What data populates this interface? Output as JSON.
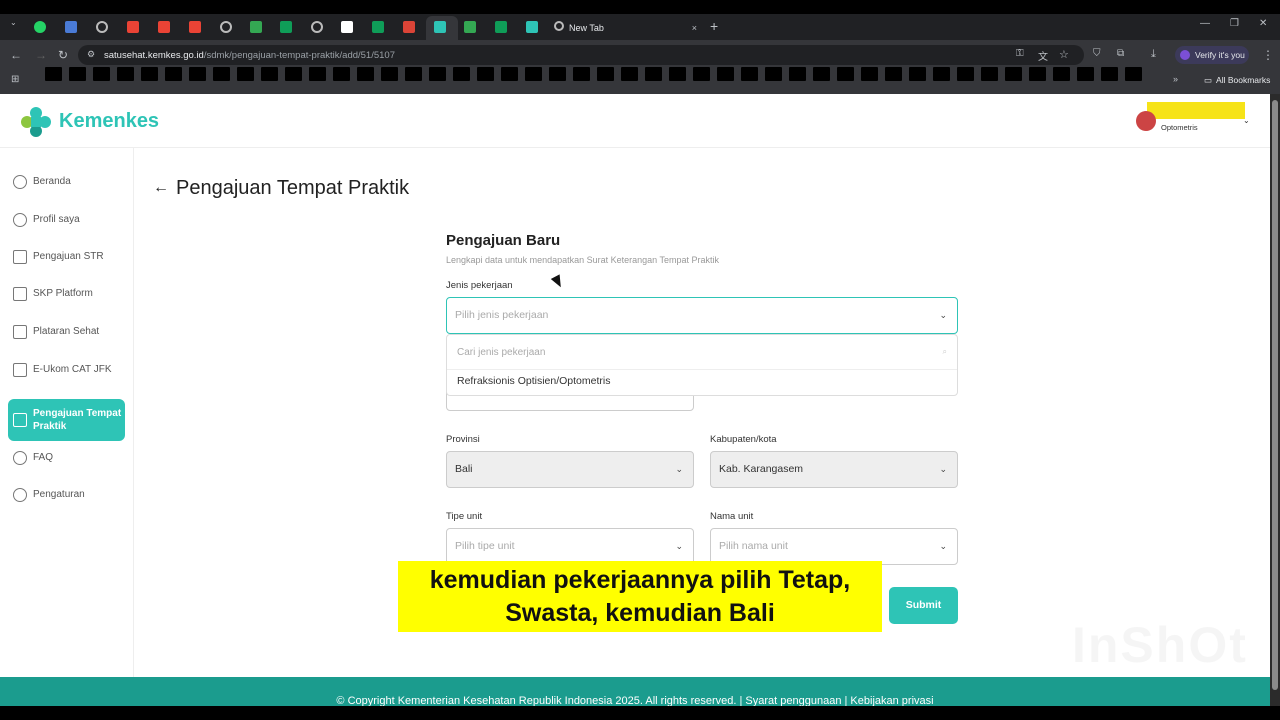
{
  "browser": {
    "new_tab_label": "New Tab",
    "url_host": "satusehat.kemkes.go.id",
    "url_path": "/sdmk/pengajuan-tempat-praktik/add/51/5107",
    "profile_label": "Verify it's you",
    "all_bookmarks": "All Bookmarks",
    "close_tab_glyph": "×",
    "new_tab_glyph": "+"
  },
  "header": {
    "brand": "Kemenkes",
    "user_role": "Optometris"
  },
  "sidebar": {
    "items": [
      {
        "label": "Beranda",
        "icon": "home-icon"
      },
      {
        "label": "Profil saya",
        "icon": "user-icon"
      },
      {
        "label": "Pengajuan STR",
        "icon": "document-icon"
      },
      {
        "label": "SKP Platform",
        "icon": "certificate-icon"
      },
      {
        "label": "Plataran Sehat",
        "icon": "book-icon"
      },
      {
        "label": "E-Ukom CAT JFK",
        "icon": "exam-icon"
      },
      {
        "label": "Pengajuan Tempat Praktik",
        "icon": "clinic-icon"
      },
      {
        "label": "FAQ",
        "icon": "question-icon"
      },
      {
        "label": "Pengaturan",
        "icon": "gear-icon"
      }
    ]
  },
  "page": {
    "title": "Pengajuan Tempat Praktik",
    "back_glyph": "←"
  },
  "form": {
    "title": "Pengajuan Baru",
    "subtitle": "Lengkapi data untuk mendapatkan Surat Keterangan Tempat Praktik",
    "jenis_label": "Jenis pekerjaan",
    "jenis_placeholder": "Pilih jenis pekerjaan",
    "dropdown_search_placeholder": "Cari jenis pekerjaan",
    "dropdown_option": "Refraksionis Optisien/Optometris",
    "provinsi_label": "Provinsi",
    "provinsi_value": "Bali",
    "kabupaten_label": "Kabupaten/kota",
    "kabupaten_value": "Kab. Karangasem",
    "tipe_label": "Tipe unit",
    "tipe_placeholder": "Pilih tipe unit",
    "nama_label": "Nama unit",
    "nama_placeholder": "Pilih nama unit",
    "submit_label": "Submit"
  },
  "caption": {
    "line1": "kemudian pekerjaannya pilih Tetap,",
    "line2": "Swasta, kemudian Bali"
  },
  "watermark": "InShOt",
  "footer": {
    "text": "© Copyright Kementerian Kesehatan Republik Indonesia 2025. All rights reserved. | Syarat penggunaan | Kebijakan privasi"
  },
  "colors": {
    "accent": "#2ec4b6",
    "footer": "#1b9c8e",
    "caption_bg": "#ffff00"
  }
}
